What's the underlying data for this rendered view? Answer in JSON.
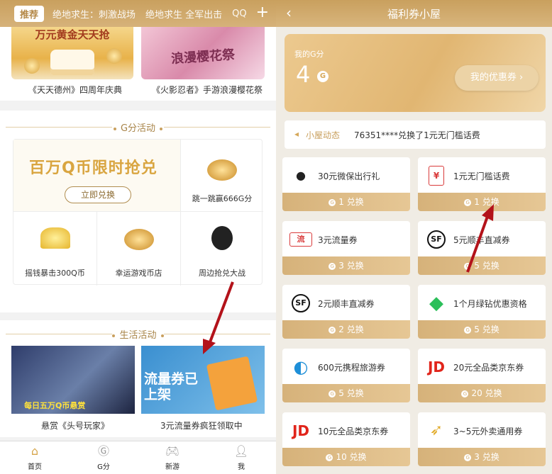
{
  "left": {
    "tabs": [
      "推荐",
      "绝地求生：刺激战场",
      "绝地求生 全军出击",
      "QQ"
    ],
    "banners": [
      {
        "img_text": "万元黄金天天抢",
        "caption": "《天天德州》四周年庆典"
      },
      {
        "img_text": "浪漫樱花祭",
        "caption": "《火影忍者》手游浪漫樱花祭"
      }
    ],
    "g_section": {
      "title": "G分活动",
      "promo_title": "百万Q币限时抢兑",
      "promo_button": "立即兑换",
      "cells": [
        "跳一跳赢666G分",
        "摇钱暴击300Q币",
        "幸运游戏币店",
        "周边抢兑大战"
      ]
    },
    "life_section": {
      "title": "生活活动",
      "items": [
        {
          "img_text": "每日五万Q币悬赏",
          "caption": "悬赏《头号玩家》"
        },
        {
          "img_text": "流量券已上架",
          "caption": "3元流量券疯狂领取中"
        }
      ]
    },
    "tabbar": [
      "首页",
      "G分",
      "新游",
      "我"
    ]
  },
  "right": {
    "title": "福利券小屋",
    "balance_label": "我的G分",
    "balance_value": "4",
    "g_icon": "G",
    "my_coupons": "我的优惠券 ›",
    "news_label": "小屋动态",
    "news_text": "76351****兑换了1元无门槛话费",
    "items": [
      {
        "name": "30元微保出行礼",
        "cost": "1 兑换",
        "icon": "penguin-icon"
      },
      {
        "name": "1元无门槛话费",
        "cost": "1 兑换",
        "icon": "phone-bill-icon"
      },
      {
        "name": "3元流量券",
        "cost": "3 兑换",
        "icon": "data-coupon-icon"
      },
      {
        "name": "5元顺丰直减券",
        "cost": "5 兑换",
        "icon": "sf-express-icon"
      },
      {
        "name": "2元顺丰直减券",
        "cost": "2 兑换",
        "icon": "sf-express-icon"
      },
      {
        "name": "1个月绿钻优惠资格",
        "cost": "5 兑换",
        "icon": "green-diamond-icon"
      },
      {
        "name": "600元携程旅游券",
        "cost": "5 兑换",
        "icon": "ctrip-dolphin-icon"
      },
      {
        "name": "20元全品类京东券",
        "cost": "20 兑换",
        "icon": "jd-icon"
      },
      {
        "name": "10元全品类京东券",
        "cost": "10 兑换",
        "icon": "jd-icon"
      },
      {
        "name": "3~5元外卖通用券",
        "cost": "3 兑换",
        "icon": "kangaroo-icon"
      }
    ],
    "icon_glyphs": {
      "sf": "SF",
      "jd": "JD",
      "phone": "¥",
      "data": "流"
    }
  }
}
